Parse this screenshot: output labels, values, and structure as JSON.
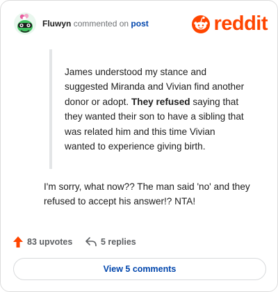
{
  "header": {
    "author": "Fluwyn",
    "verb": "commented on",
    "link": "post",
    "brand": "reddit"
  },
  "quote": {
    "before_bold": "James understood my stance and suggested Miranda and Vivian find another donor or adopt. ",
    "bold": "They refused",
    "after_bold": " saying that they wanted their son to have a sibling that was related him and this time Vivian wanted to experience giving birth."
  },
  "comment": {
    "text": "I'm sorry, what now?? The man said 'no' and they refused to accept his answer!? NTA!"
  },
  "actions": {
    "upvotes": "83 upvotes",
    "replies": "5 replies"
  },
  "view_button": "View 5 comments",
  "colors": {
    "brand": "#ff4500",
    "link": "#0045ac",
    "muted": "#5c5f62"
  },
  "icons": {
    "avatar": "snoo-avatar-green",
    "logo": "reddit-snoo-logo",
    "upvote": "upvote-arrow-icon",
    "reply": "reply-arrow-icon"
  }
}
